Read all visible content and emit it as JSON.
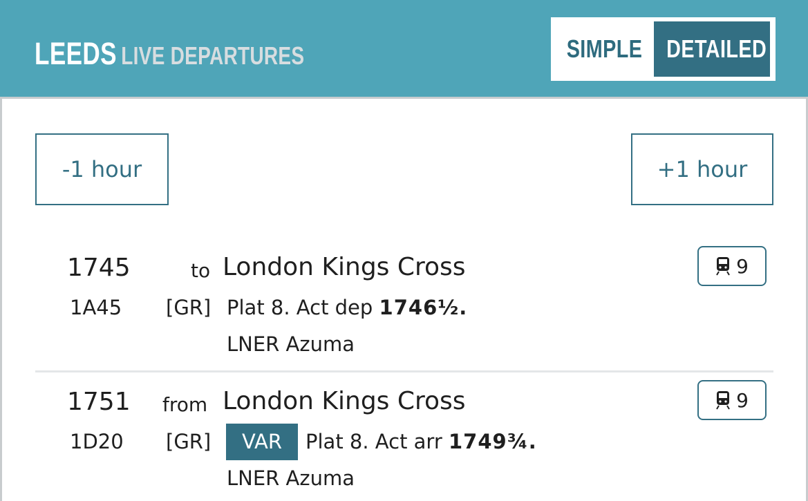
{
  "header": {
    "station": "LEEDS",
    "subtitle": "LIVE DEPARTURES",
    "view_toggle": {
      "simple": "SIMPLE",
      "detailed": "DETAILED",
      "selected": "DETAILED"
    }
  },
  "controls": {
    "prev_hour": "-1 hour",
    "next_hour": "+1 hour"
  },
  "services": [
    {
      "time": "1745",
      "direction": "to",
      "destination": "London Kings Cross",
      "headcode": "1A45",
      "operator": "[GR]",
      "tag": "",
      "detail_prefix": "Plat 8. Act dep ",
      "detail_time": "1746½",
      "detail_suffix": ".",
      "stock": "LNER Azuma",
      "coaches": "9",
      "coach_icon": "train-icon"
    },
    {
      "time": "1751",
      "direction": "from",
      "destination": "London Kings Cross",
      "headcode": "1D20",
      "operator": "[GR]",
      "tag": "VAR",
      "detail_prefix": "Plat 8. Act arr ",
      "detail_time": "1749¾",
      "detail_suffix": ".",
      "stock": "LNER Azuma",
      "coaches": "9",
      "coach_icon": "train-icon"
    }
  ],
  "colors": {
    "header_bg": "#4fa5b8",
    "accent": "#336f83",
    "subtitle": "#d7dde0"
  }
}
